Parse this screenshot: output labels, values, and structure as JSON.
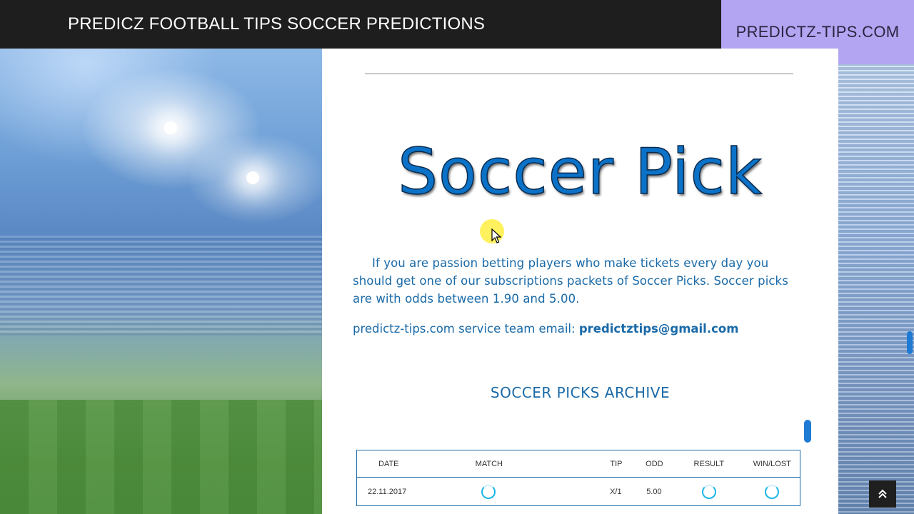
{
  "header": {
    "site_title": "PREDICZ FOOTBALL TIPS SOCCER PREDICTIONS",
    "brand_badge": "PREDICTZ-TIPS.COM"
  },
  "main": {
    "hero_title": "Soccer Pick",
    "intro": "If you are passion betting players who make tickets every day you should get one of our subscriptions packets of  Soccer Picks. Soccer picks are with odds between 1.90 and 5.00.",
    "contact_prefix": "predictz-tips.com service team email: ",
    "contact_email": "predictztips@gmail.com",
    "archive_title": "SOCCER PICKS ARCHIVE"
  },
  "table": {
    "columns": [
      "DATE",
      "MATCH",
      "TIP",
      "ODD",
      "RESULT",
      "WIN/LOST"
    ],
    "rows": [
      {
        "date": "22.11.2017",
        "tip": "X/1",
        "odd": "5.00"
      }
    ]
  },
  "colors": {
    "accent": "#0b72c8",
    "text_blue": "#1a6aa8",
    "badge_bg": "#b3a5f1",
    "topbar_bg": "#1e1e1e"
  },
  "icons": {
    "back_to_top": "double-chevron-up-icon",
    "loading": "spinner-icon"
  }
}
